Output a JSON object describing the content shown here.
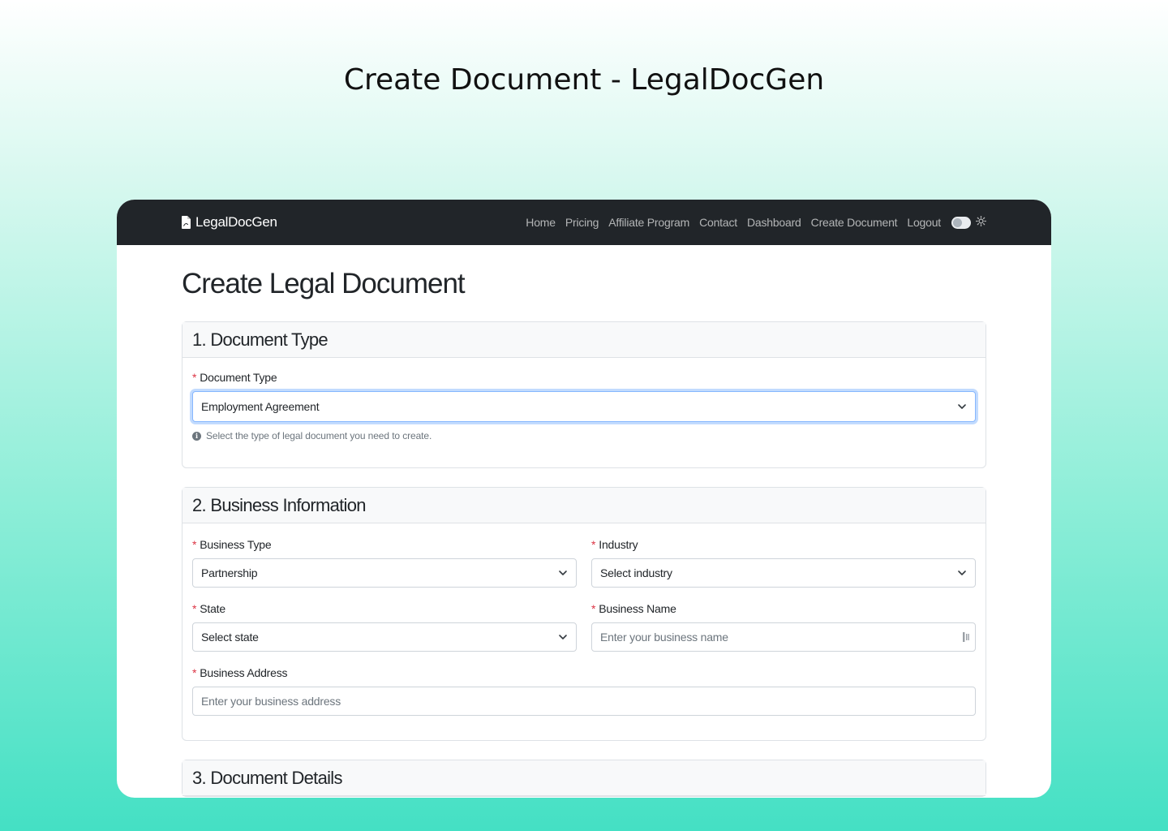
{
  "page_heading": "Create Document - LegalDocGen",
  "navbar": {
    "brand": "LegalDocGen",
    "links": [
      "Home",
      "Pricing",
      "Affiliate Program",
      "Contact",
      "Dashboard",
      "Create Document",
      "Logout"
    ],
    "theme_toggle_icon": "sun-icon"
  },
  "title": "Create Legal Document",
  "section1": {
    "header": "1. Document Type",
    "doc_type_label": "Document Type",
    "doc_type_value": "Employment Agreement",
    "help_text": "Select the type of legal document you need to create."
  },
  "section2": {
    "header": "2. Business Information",
    "business_type_label": "Business Type",
    "business_type_value": "Partnership",
    "industry_label": "Industry",
    "industry_value": "Select industry",
    "state_label": "State",
    "state_value": "Select state",
    "business_name_label": "Business Name",
    "business_name_placeholder": "Enter your business name",
    "business_address_label": "Business Address",
    "business_address_placeholder": "Enter your business address"
  },
  "section3": {
    "header": "3. Document Details"
  },
  "colors": {
    "navbar": "#212529",
    "required": "#dc3545",
    "focus": "#86b7fe"
  }
}
